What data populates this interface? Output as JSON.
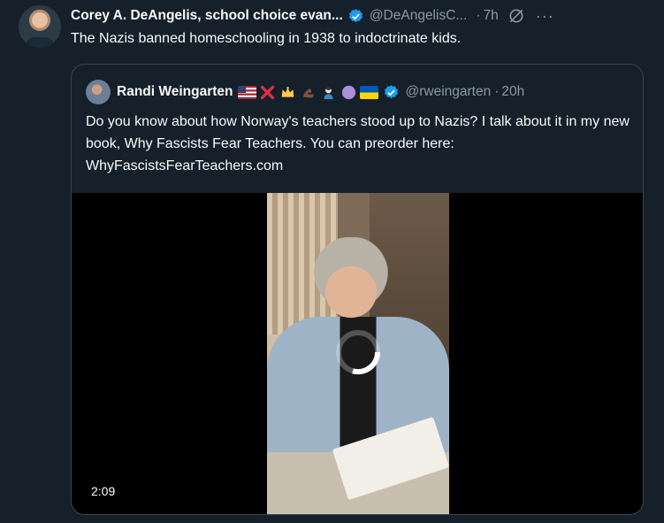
{
  "tweet": {
    "author_name": "Corey A. DeAngelis, school choice evan...",
    "author_handle": "@DeAngelisC...",
    "separator": "·",
    "time": "7h",
    "more": "···",
    "text": "The Nazis banned homeschooling in 1938 to indoctrinate kids."
  },
  "quote": {
    "author_name": "Randi Weingarten",
    "author_handle": "@rweingarten",
    "separator": "·",
    "time": "20h",
    "emojis": [
      "us-flag",
      "cross-mark",
      "crown",
      "flexed-biceps",
      "teacher",
      "purple-circle",
      "ukraine-flag"
    ],
    "text": "Do you know about how Norway's teachers stood up to Nazis? I talk about it in my new book, Why Fascists Fear Teachers. You can preorder here:  WhyFascistsFearTeachers.com",
    "video": {
      "duration": "2:09",
      "spinner_icon": "loading-spinner-icon"
    }
  },
  "colors": {
    "background": "#15202b",
    "text": "#f7f9f9",
    "secondary": "#8b98a5",
    "verified": "#1d9bf0",
    "border": "#38444d"
  }
}
